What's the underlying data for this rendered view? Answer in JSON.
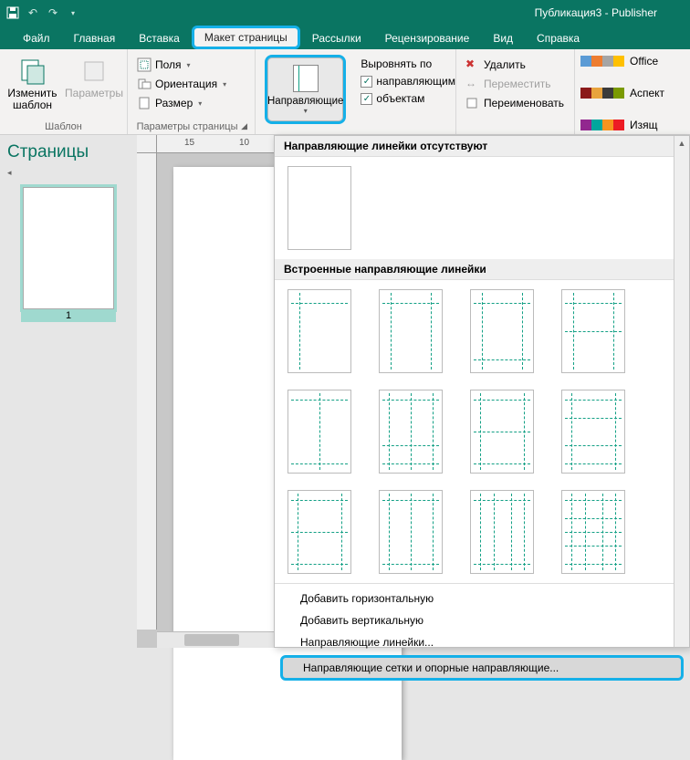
{
  "titlebar": {
    "title": "Публикация3 - Publisher"
  },
  "tabs": {
    "file": "Файл",
    "home": "Главная",
    "insert": "Вставка",
    "page_layout": "Макет страницы",
    "mailings": "Рассылки",
    "review": "Рецензирование",
    "view": "Вид",
    "help": "Справка"
  },
  "ribbon": {
    "template": {
      "change": "Изменить шаблон",
      "options": "Параметры",
      "label": "Шаблон"
    },
    "page_setup": {
      "margins": "Поля",
      "orientation": "Ориентация",
      "size": "Размер",
      "label": "Параметры страницы"
    },
    "layout": {
      "guides": "Направляющие",
      "align_to": "Выровнять по",
      "to_guides": "направляющим",
      "to_objects": "объектам"
    },
    "pages": {
      "delete": "Удалить",
      "move": "Переместить",
      "rename": "Переименовать"
    },
    "schemes": {
      "s1": "Office",
      "s2": "Аспект",
      "s3": "Изящ"
    }
  },
  "left": {
    "heading": "Страницы",
    "page_num": "1"
  },
  "ruler": {
    "t1": "15",
    "t2": "10"
  },
  "dropdown": {
    "sec1": "Направляющие линейки отсутствуют",
    "sec2": "Встроенные направляющие линейки",
    "menu": {
      "add_h": "Добавить горизонтальную",
      "add_v": "Добавить вертикальную",
      "ruler_guides": "Направляющие линейки...",
      "grid_guides": "Направляющие сетки и опорные направляющие..."
    }
  }
}
